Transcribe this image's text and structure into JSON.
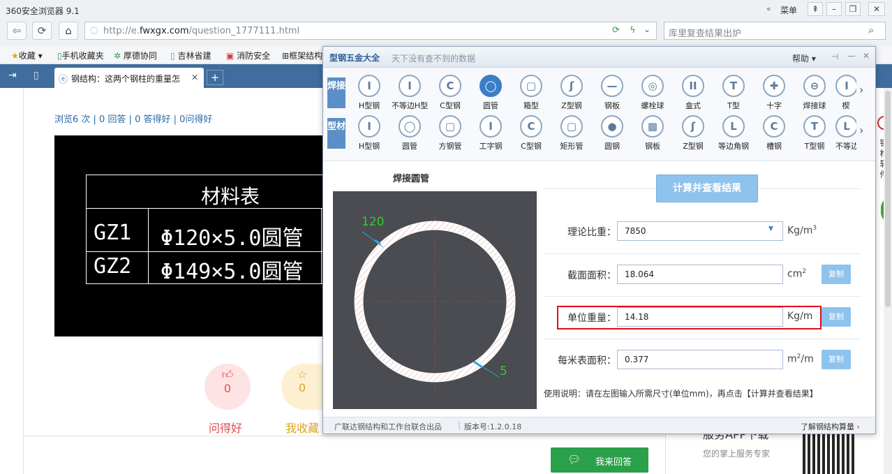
{
  "browser": {
    "title": "360安全浏览器 9.1",
    "menu_label": "菜单",
    "url_prefix": "http://e.",
    "url_domain": "fwxgx.com",
    "url_path": "/question_1777111.html",
    "search_placeholder": "库里复查结果出炉"
  },
  "bookmarks": [
    "收藏",
    "手机收藏夹",
    "厚德协同",
    "吉林省建",
    "消防安全",
    "框架结构"
  ],
  "tab": {
    "label": "钢结构：这两个钢柱的重量怎"
  },
  "page": {
    "stats": "浏览6 次 | 0 回答 | 0 答得好 | 0问得好",
    "cad": {
      "title": "材料表",
      "rows": [
        {
          "id": "GZ1",
          "spec": "Φ120×5.0圆管"
        },
        {
          "id": "GZ2",
          "spec": "Φ149×5.0圆管"
        }
      ]
    },
    "good_question": {
      "count": "0",
      "label": "问得好"
    },
    "favorite": {
      "count": "0",
      "label": "我收藏"
    },
    "answer_label": "我来回答",
    "service_title": "服务APP下载",
    "service_sub": "您的掌上服务专家"
  },
  "panel": {
    "app_name": "型钢五金大全",
    "slogan": "天下没有查不到的数据",
    "help_label": "帮助",
    "row1_label": "焊接",
    "row2_label": "型材",
    "row1": [
      "H型钢",
      "不等边H型",
      "C型钢",
      "圆管",
      "箱型",
      "Z型钢",
      "钢板",
      "螺栓球",
      "盒式",
      "T型",
      "十字",
      "焊接球",
      "楔"
    ],
    "row2": [
      "H型钢",
      "圆管",
      "方钢管",
      "工字钢",
      "C型钢",
      "矩形管",
      "圆钢",
      "钢板",
      "Z型钢",
      "等边角钢",
      "槽钢",
      "T型钢",
      "不等边"
    ],
    "diagram_title": "焊接圆管",
    "diagram_outer": "120",
    "diagram_thick": "5",
    "calc_label": "计算并查看结果",
    "density_label": "理论比重：",
    "density_value": "7850",
    "density_unit": "Kg/m",
    "area_label": "截面面积：",
    "area_value": "18.064",
    "area_unit": "cm",
    "weight_label": "单位重量：",
    "weight_value": "14.18",
    "weight_unit": "Kg/m",
    "surface_label": "每米表面积：",
    "surface_value": "0.377",
    "surface_unit": "m",
    "surface_unit_tail": "/m",
    "copy_label": "复制",
    "usage": "使用说明：请在左图输入所需尺寸(单位mm)，再点击【计算并查看结果】",
    "footer_left": "广联达钢结构和工作台联合出品",
    "version": "版本号:1.2.0.18",
    "footer_right": "了解钢结构算量"
  },
  "colors": {
    "accent": "#3c7ec5",
    "highlight": "#d8101a",
    "green": "#2ba04a"
  }
}
